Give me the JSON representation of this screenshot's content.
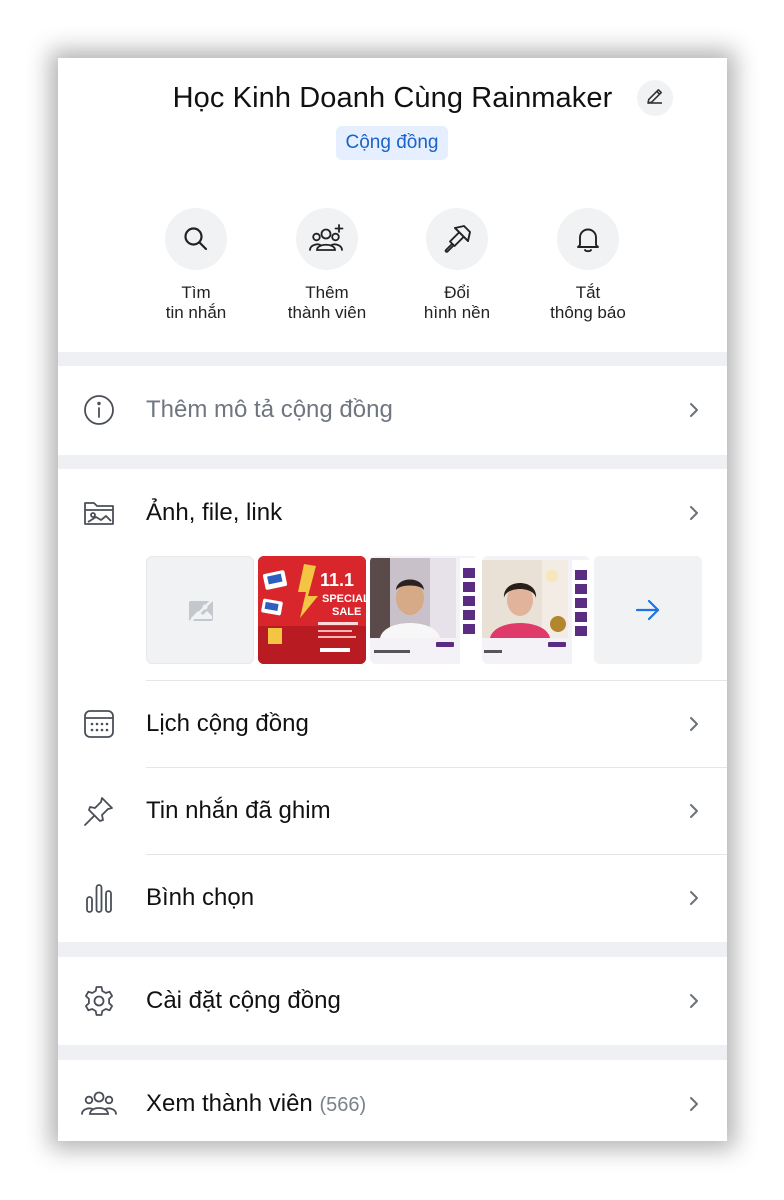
{
  "header": {
    "title": "Học Kinh Doanh Cùng Rainmaker",
    "badge": "Cộng đồng"
  },
  "actions": [
    {
      "line1": "Tìm",
      "line2": "tin nhắn",
      "icon": "search-icon"
    },
    {
      "line1": "Thêm",
      "line2": "thành viên",
      "icon": "add-member-icon"
    },
    {
      "line1": "Đổi",
      "line2": "hình nền",
      "icon": "paint-brush-icon"
    },
    {
      "line1": "Tắt",
      "line2": "thông báo",
      "icon": "bell-icon"
    }
  ],
  "menu": {
    "description": "Thêm mô tả cộng đồng",
    "media": "Ảnh, file, link",
    "calendar": "Lịch cộng đồng",
    "pinned": "Tin nhắn đã ghim",
    "poll": "Bình chọn",
    "settings": "Cài đặt cộng đồng",
    "members": "Xem thành viên",
    "members_count": "(566)"
  },
  "media_preview": {
    "thumb_promo_1": "11.1",
    "thumb_promo_2": "SPECIAL",
    "thumb_promo_3": "SALE"
  },
  "colors": {
    "accent": "#1a63c8",
    "badge_bg": "#e5efff",
    "separator": "#eef0f3",
    "promo_red": "#d8262c"
  }
}
